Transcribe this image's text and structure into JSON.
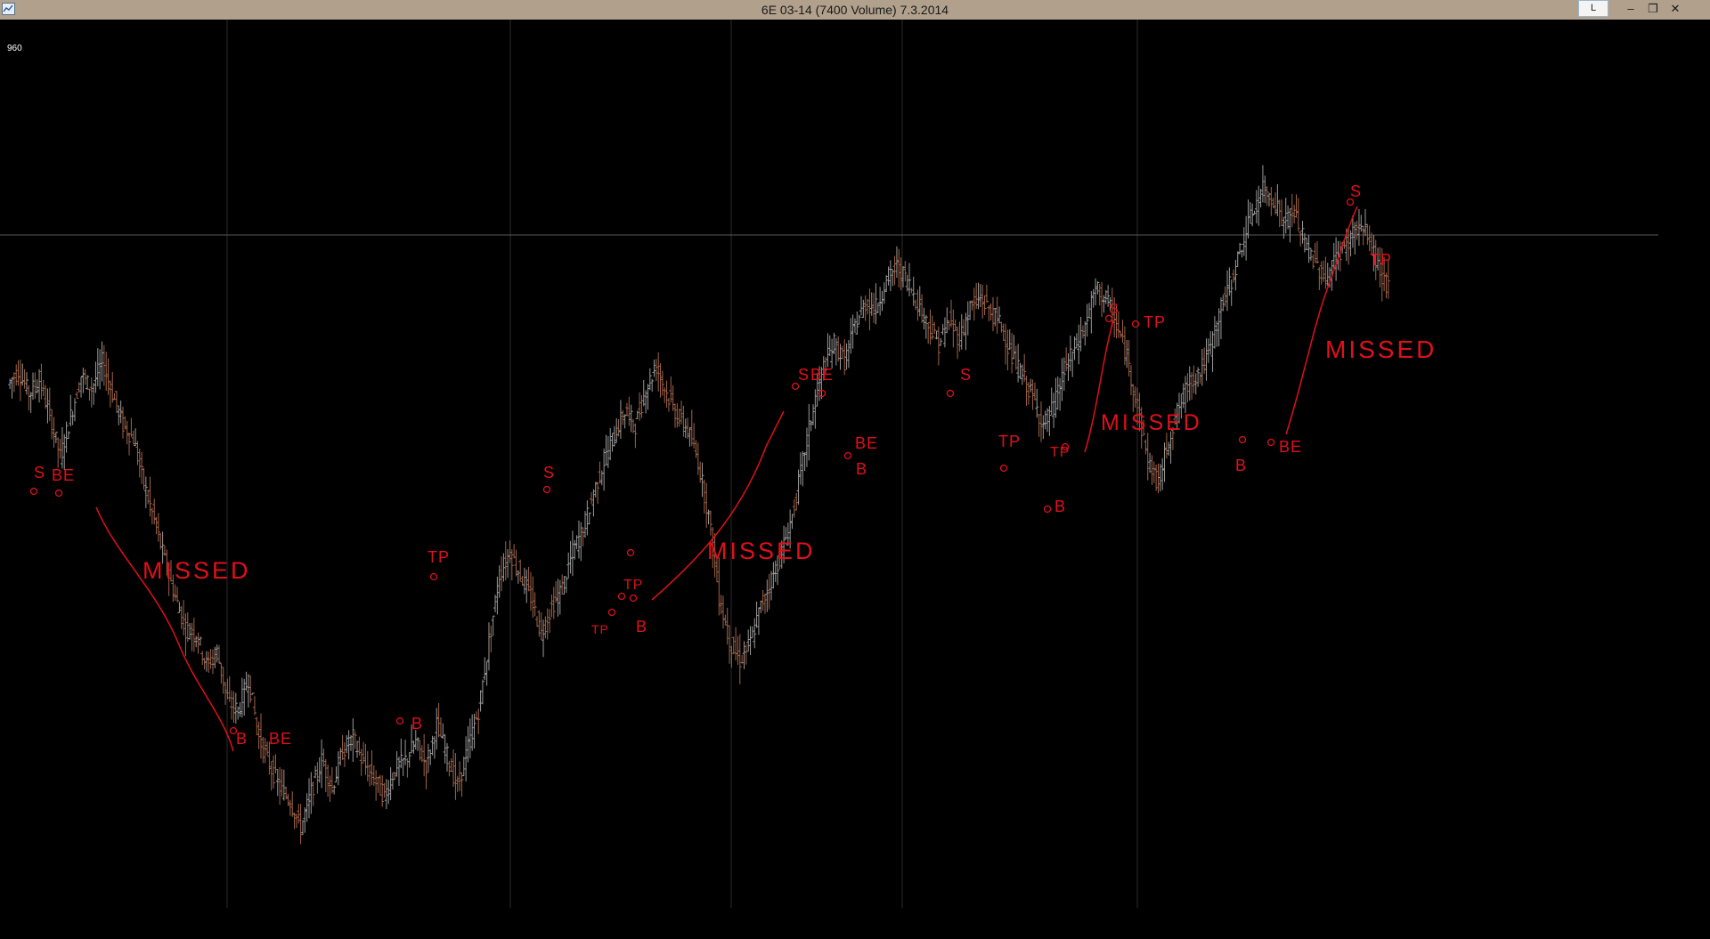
{
  "window": {
    "title": "6E 03-14 (7400 Volume)  7.3.2014",
    "l_button": "L",
    "minimize_glyph": "–",
    "restore_glyph": "❐",
    "close_glyph": "✕"
  },
  "colors": {
    "background": "#000000",
    "up_bar": "#9a9a9a",
    "down_bar": "#a0644a",
    "annotation": "#e0101a",
    "grid": "#2a2a2a",
    "level_line": "#5a5a5a",
    "titlebar": "#b1a08c"
  },
  "chart_data": {
    "type": "line",
    "chart_style": "ohlc-bars",
    "price_label": "960",
    "level_line_price": 960,
    "grid": true,
    "series": [
      {
        "values": [
          927,
          930,
          925,
          928,
          920,
          911,
          920,
          929,
          926,
          932,
          925,
          918,
          915,
          905,
          897,
          888,
          880,
          873,
          872,
          865,
          868,
          857,
          855,
          862,
          849,
          843,
          838,
          835,
          829,
          837,
          844,
          838,
          846,
          849,
          843,
          840,
          836,
          842,
          844,
          848,
          843,
          852,
          845,
          838,
          847,
          855,
          870,
          885,
          890,
          885,
          880,
          872,
          878,
          882,
          890,
          895,
          903,
          910,
          916,
          921,
          918,
          926,
          931,
          925,
          920,
          917,
          910,
          898,
          880,
          870,
          866,
          870,
          878,
          884,
          890,
          898,
          910,
          922,
          931,
          936,
          932,
          940,
          945,
          944,
          950,
          953,
          950,
          945,
          940,
          936,
          941,
          937,
          944,
          946,
          943,
          940,
          933,
          929,
          924,
          918,
          922,
          930,
          935,
          940,
          948,
          946,
          940,
          933,
          922,
          910,
          905,
          915,
          922,
          928,
          930,
          935,
          944,
          950,
          958,
          965,
          970,
          968,
          963,
          965,
          958,
          954,
          950,
          955,
          958,
          962,
          960,
          953,
          948
        ]
      }
    ],
    "annotations": [
      {
        "text": "S",
        "kind": "signal"
      },
      {
        "text": "BE",
        "kind": "signal"
      },
      {
        "text": "MISSED",
        "kind": "note"
      },
      {
        "text": "B",
        "kind": "signal"
      },
      {
        "text": "BE",
        "kind": "signal"
      },
      {
        "text": "B",
        "kind": "signal"
      },
      {
        "text": "TP",
        "kind": "signal"
      },
      {
        "text": "S",
        "kind": "signal"
      },
      {
        "text": "TP",
        "kind": "signal"
      },
      {
        "text": "TP",
        "kind": "signal"
      },
      {
        "text": "B",
        "kind": "signal"
      },
      {
        "text": "MISSED",
        "kind": "note"
      },
      {
        "text": "S",
        "kind": "signal"
      },
      {
        "text": "BE",
        "kind": "signal"
      },
      {
        "text": "BE",
        "kind": "signal"
      },
      {
        "text": "B",
        "kind": "signal"
      },
      {
        "text": "S",
        "kind": "signal"
      },
      {
        "text": "TP",
        "kind": "signal"
      },
      {
        "text": "TP",
        "kind": "signal"
      },
      {
        "text": "B",
        "kind": "signal"
      },
      {
        "text": "S",
        "kind": "signal"
      },
      {
        "text": "TP",
        "kind": "signal"
      },
      {
        "text": "MISSED",
        "kind": "note"
      },
      {
        "text": "B",
        "kind": "signal"
      },
      {
        "text": "BE",
        "kind": "signal"
      },
      {
        "text": "MISSED",
        "kind": "note"
      },
      {
        "text": "S",
        "kind": "signal"
      },
      {
        "text": "TP",
        "kind": "signal"
      }
    ]
  }
}
